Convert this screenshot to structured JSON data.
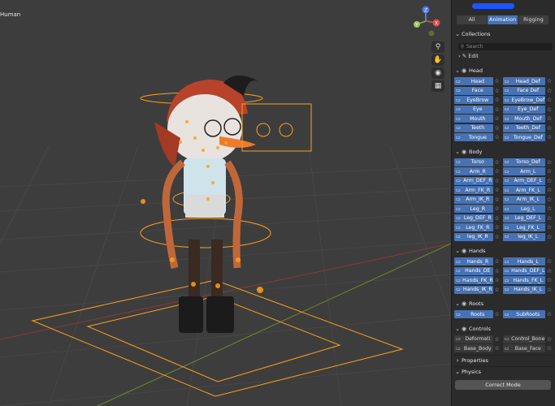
{
  "viewport": {
    "object_label": "Human"
  },
  "gizmo": {
    "x": "X",
    "y": "Y",
    "z": "Z"
  },
  "nav_icons": [
    "zoom-icon",
    "pan-hand-icon",
    "camera-icon",
    "grid-view-icon"
  ],
  "tabs": [
    "All",
    "Animation",
    "Rigging"
  ],
  "active_tab": "Animation",
  "collections_header": "Collections",
  "search_placeholder": "Search",
  "edit_label": "Edit",
  "groups": [
    {
      "title": "Head",
      "rows": [
        [
          "Head",
          "Head_Def"
        ],
        [
          "Face",
          "Face Def"
        ],
        [
          "EyeBrow",
          "EyeBrow_Def"
        ],
        [
          "Eye",
          "Eye_Def"
        ],
        [
          "Mouth",
          "Mouth_Def"
        ],
        [
          "Teeth",
          "Teeth_Def"
        ],
        [
          "Tongue",
          "Tongue_Def"
        ]
      ]
    },
    {
      "title": "Body",
      "rows": [
        [
          "Torso",
          "Torso_Def"
        ],
        [
          "Arm_R",
          "Arm_L"
        ],
        [
          "Arm_DEF_R",
          "Arm_DEF_L"
        ],
        [
          "Arm_FK_R",
          "Arm_FK_L"
        ],
        [
          "Arm_IK_R",
          "Arm_IK_L"
        ],
        [
          "Leg_R",
          "Leg_L"
        ],
        [
          "Leg_DEF_R",
          "Leg_DEF_L"
        ],
        [
          "Leg_FK_R",
          "Leg_FK_L"
        ],
        [
          "leg_IK_R",
          "leg_IK_L"
        ]
      ]
    },
    {
      "title": "Hands",
      "rows": [
        [
          "Hands_R",
          "Hands_L"
        ],
        [
          "Hands_DE",
          "Hands_DEF_L"
        ],
        [
          "Hands_FK_R",
          "Hands_FK_L"
        ],
        [
          "Hands_IK_R",
          "Hands_IK_L"
        ]
      ]
    },
    {
      "title": "Roots",
      "rows": [
        [
          "Roots",
          "SubRoots"
        ]
      ]
    },
    {
      "title": "Controls",
      "off": true,
      "rows": [
        [
          "Deformati",
          "Control_Bone"
        ],
        [
          "Base_Body",
          "Base_Face"
        ]
      ]
    }
  ],
  "properties_label": "Properties",
  "physics_label": "Physics",
  "correct_mode_label": "Correct Mode",
  "colors": {
    "accent": "#4772b3",
    "viewport": "#3d3d3d",
    "panel": "#2b2b2b",
    "bone": "#ff9f1a"
  }
}
